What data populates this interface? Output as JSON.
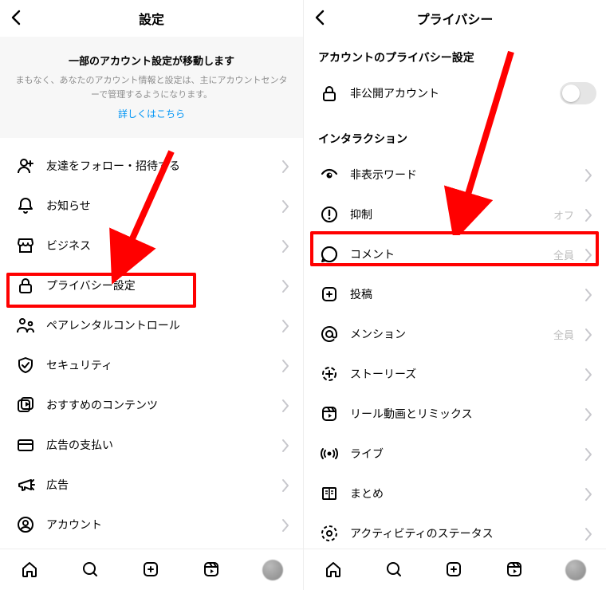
{
  "left": {
    "title": "設定",
    "banner": {
      "title": "一部のアカウント設定が移動します",
      "sub": "まもなく、あなたのアカウント情報と設定は、主にアカウントセンターで管理するようになります。",
      "link": "詳しくはこちら"
    },
    "items": [
      {
        "label": "友達をフォロー・招待する"
      },
      {
        "label": "お知らせ"
      },
      {
        "label": "ビジネス"
      },
      {
        "label": "プライバシー設定"
      },
      {
        "label": "ペアレンタルコントロール"
      },
      {
        "label": "セキュリティ"
      },
      {
        "label": "おすすめのコンテンツ"
      },
      {
        "label": "広告の支払い"
      },
      {
        "label": "広告"
      },
      {
        "label": "アカウント"
      }
    ]
  },
  "right": {
    "title": "プライバシー",
    "section1": "アカウントのプライバシー設定",
    "private": "非公開アカウント",
    "section2": "インタラクション",
    "items": [
      {
        "label": "非表示ワード",
        "value": ""
      },
      {
        "label": "抑制",
        "value": "オフ"
      },
      {
        "label": "コメント",
        "value": "全員"
      },
      {
        "label": "投稿",
        "value": ""
      },
      {
        "label": "メンション",
        "value": "全員"
      },
      {
        "label": "ストーリーズ",
        "value": ""
      },
      {
        "label": "リール動画とリミックス",
        "value": ""
      },
      {
        "label": "ライブ",
        "value": ""
      },
      {
        "label": "まとめ",
        "value": ""
      },
      {
        "label": "アクティビティのステータス",
        "value": ""
      }
    ]
  }
}
